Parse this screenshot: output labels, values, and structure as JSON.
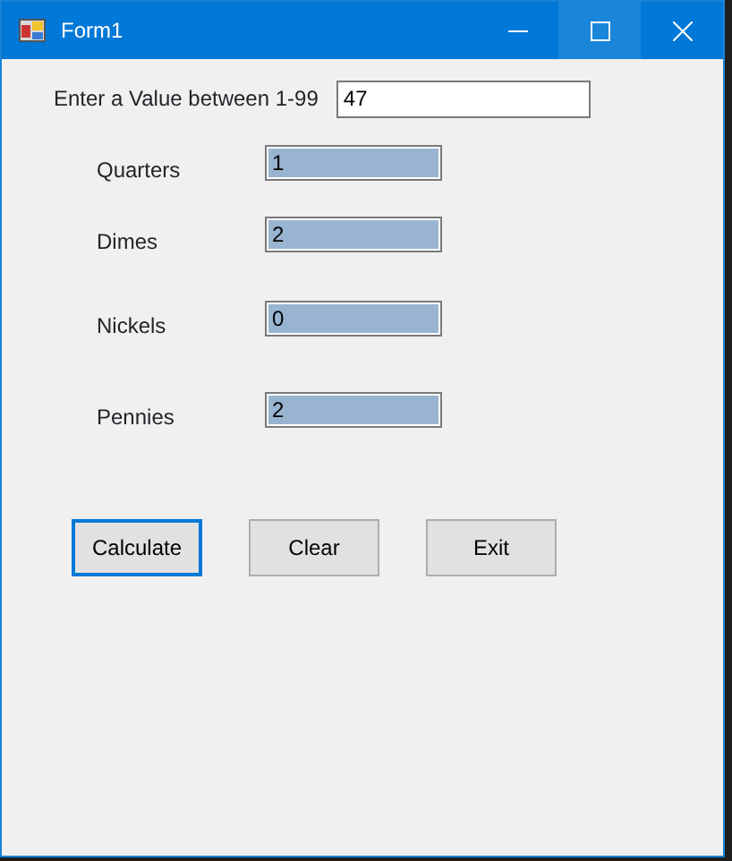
{
  "window": {
    "title": "Form1"
  },
  "input": {
    "label": "Enter a Value between 1-99",
    "value": "47"
  },
  "coins": [
    {
      "label": "Quarters",
      "value": "1"
    },
    {
      "label": "Dimes",
      "value": "2"
    },
    {
      "label": "Nickels",
      "value": "0"
    },
    {
      "label": "Pennies",
      "value": "2"
    }
  ],
  "buttons": [
    {
      "label": "Calculate",
      "focused": true
    },
    {
      "label": "Clear",
      "focused": false
    },
    {
      "label": "Exit",
      "focused": false
    }
  ]
}
